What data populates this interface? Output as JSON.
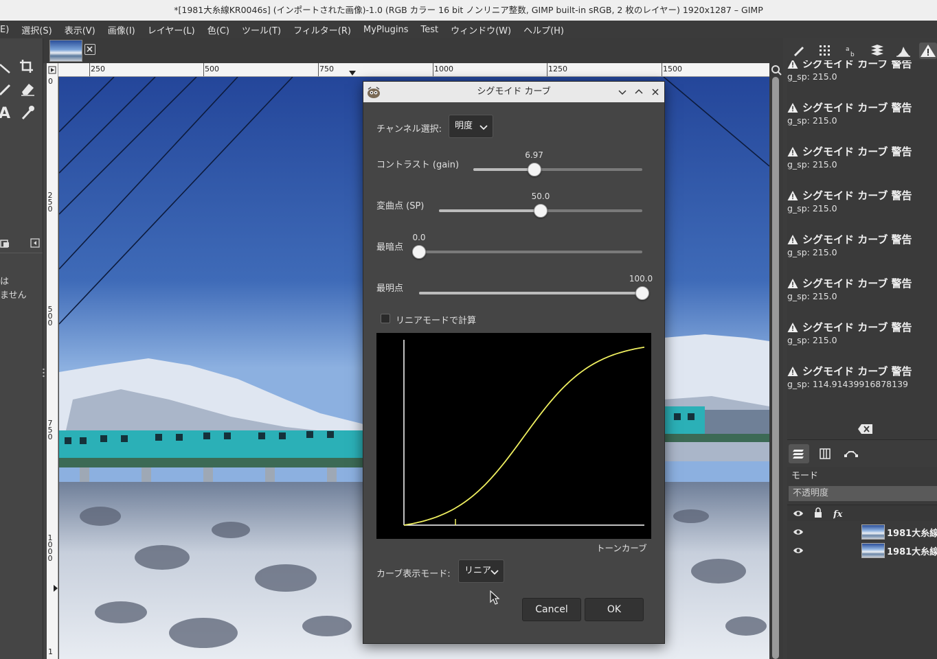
{
  "window": {
    "title": "*[1981大糸線KR0046s] (インポートされた画像)-1.0 (RGB カラー 16 bit ノンリニア整数, GIMP built-in sRGB, 2 枚のレイヤー) 1920x1287 – GIMP"
  },
  "menu": [
    {
      "label": "E)"
    },
    {
      "label": "選択(S)"
    },
    {
      "label": "表示(V)"
    },
    {
      "label": "画像(I)"
    },
    {
      "label": "レイヤー(L)"
    },
    {
      "label": "色(C)"
    },
    {
      "label": "ツール(T)"
    },
    {
      "label": "フィルター(R)"
    },
    {
      "label": "MyPlugins"
    },
    {
      "label": "Test"
    },
    {
      "label": "ウィンドウ(W)"
    },
    {
      "label": "ヘルプ(H)"
    }
  ],
  "toolbox": {
    "text_line1": "は",
    "text_line2": "ません"
  },
  "ruler": {
    "h_labels": [
      "250",
      "500",
      "750",
      "1000",
      "1250",
      "1500"
    ],
    "v_labels": [
      "0",
      "250",
      "500",
      "750",
      "1000",
      "1"
    ]
  },
  "dialog": {
    "title": "シグモイド カーブ",
    "channel_label": "チャンネル選択:",
    "channel_value": "明度",
    "contrast_label": "コントラスト (gain)",
    "contrast_value": "6.97",
    "contrast_fraction": 0.36,
    "sp_label": "変曲点 (SP)",
    "sp_value": "50.0",
    "sp_fraction": 0.5,
    "dark_label": "最暗点",
    "dark_value": "0.0",
    "dark_fraction": 0.0,
    "bright_label": "最明点",
    "bright_value": "100.0",
    "bright_fraction": 1.0,
    "linear_checkbox_label": "リニアモードで計算",
    "linear_checked": false,
    "curve_caption": "トーンカーブ",
    "curve_mode_label": "カーブ表示モード:",
    "curve_mode_value": "リニア",
    "cancel_label": "Cancel",
    "ok_label": "OK",
    "curve_color": "#f0f060"
  },
  "messages": [
    {
      "title": "シグモイド カーブ 警告",
      "detail": "g_sp: 215.0"
    },
    {
      "title": "シグモイド カーブ 警告",
      "detail": "g_sp: 215.0"
    },
    {
      "title": "シグモイド カーブ 警告",
      "detail": "g_sp: 215.0"
    },
    {
      "title": "シグモイド カーブ 警告",
      "detail": "g_sp: 215.0"
    },
    {
      "title": "シグモイド カーブ 警告",
      "detail": "g_sp: 215.0"
    },
    {
      "title": "シグモイド カーブ 警告",
      "detail": "g_sp: 215.0"
    },
    {
      "title": "シグモイド カーブ 警告",
      "detail": "g_sp: 215.0"
    },
    {
      "title": "シグモイド カーブ 警告",
      "detail": "g_sp: 114.91439916878139"
    }
  ],
  "layers_panel": {
    "mode_label": "モード",
    "opacity_label": "不透明度",
    "layers": [
      {
        "name": "1981大糸線"
      },
      {
        "name": "1981大糸線"
      }
    ]
  }
}
